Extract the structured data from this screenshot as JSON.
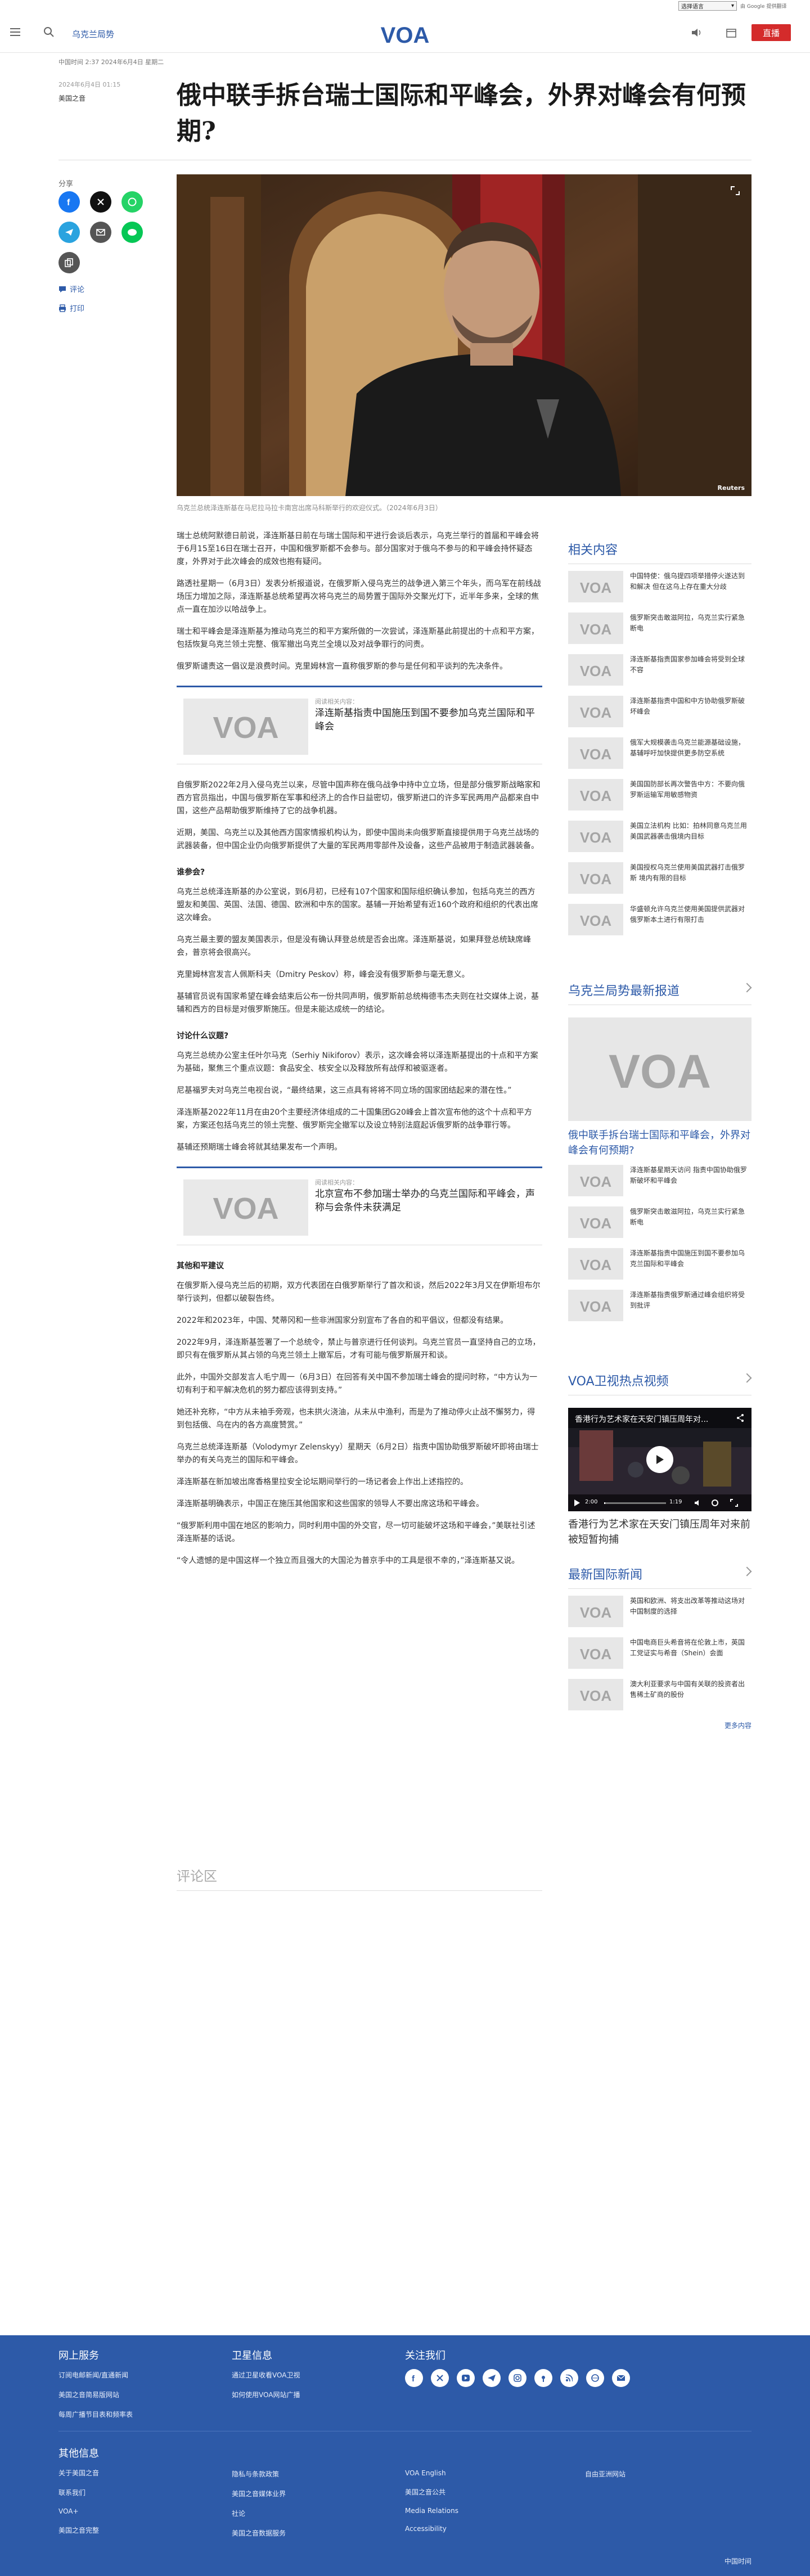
{
  "topbar": {
    "language_select": "选择语言",
    "google_translate": "由 Google 提供翻译"
  },
  "header": {
    "section": "乌克兰局势",
    "live": "直播",
    "logo": "VOA"
  },
  "article": {
    "kicker": "中国时间 2:37 2024年6月4日 星期二",
    "date": "2024年6月4日 01:15",
    "category": "美国之音",
    "title": "俄中联手拆台瑞士国际和平峰会，外界对峰会有何预期?",
    "share_label": "分享",
    "comment_link": "评论",
    "print_link": "打印",
    "photo_credit": "Reuters",
    "caption": "乌克兰总统泽连斯基在马尼拉马拉卡南宫出席马科斯举行的欢迎仪式。（2024年6月3日）",
    "paragraphs_a": [
      "瑞士总统阿默德日前说，泽连斯基日前在与瑞士国际和平进行会谈后表示，乌克兰举行的首届和平峰会将于6月15至16日在瑞士召开，中国和俄罗斯都不会参与。部分国家对于俄乌不参与的和平峰会持怀疑态度，外界对于此次峰会的成效也抱有疑问。",
      "路透社星期一（6月3日）发表分析报道说，在俄罗斯入侵乌克兰的战争进入第三个年头，而乌军在前线战场压力增加之际，泽连斯基总统希望再次将乌克兰的局势置于国际外交聚光灯下，近半年多来，全球的焦点一直在加沙以哈战争上。",
      "瑞士和平峰会是泽连斯基为推动乌克兰的和平方案所做的一次尝试，泽连斯基此前提出的十点和平方案，包括恢复乌克兰领土完整、俄军撤出乌克兰全境以及对战争罪行的问责。",
      "俄罗斯谴责这一倡议是浪费时间。克里姆林宫一直称俄罗斯的参与是任何和平谈判的先决条件。"
    ],
    "related_1": {
      "label": "阅读相关内容：",
      "title": "泽连斯基指责中国施压到国不要参加乌克兰国际和平峰会"
    },
    "paragraphs_b": [
      "自俄罗斯2022年2月入侵乌克兰以来，尽管中国声称在俄乌战争中持中立立场，但是部分俄罗斯战略家和西方官员指出，中国与俄罗斯在军事和经济上的合作日益密切，俄罗斯进口的许多军民两用产品都来自中国，这些产品帮助俄罗斯维持了它的战争机器。",
      "近期，美国、乌克兰以及其他西方国家情报机构认为，即使中国尚未向俄罗斯直接提供用于乌克兰战场的武器装备，但中国企业仍向俄罗斯提供了大量的军民两用零部件及设备，这些产品被用于制造武器装备。"
    ],
    "h_who": "谁参会?",
    "paragraphs_c": [
      "乌克兰总统泽连斯基的办公室说，到6月初，已经有107个国家和国际组织确认参加，包括乌克兰的西方盟友和美国、英国、法国、德国、欧洲和中东的国家。基辅一开始希望有近160个政府和组织的代表出席这次峰会。",
      "乌克兰最主要的盟友美国表示，但是没有确认拜登总统是否会出席。泽连斯基说，如果拜登总统缺席峰会，普京将会很高兴。",
      "克里姆林宫发言人佩斯科夫（Dmitry Peskov）称，峰会没有俄罗斯参与毫无意义。",
      "基辅官员说有国家希望在峰会结束后公布一份共同声明，俄罗斯前总统梅德韦杰夫则在社交媒体上说，基辅和西方的目标是对俄罗斯施压。但是未能达成统一的结论。"
    ],
    "h_topics": "讨论什么议题?",
    "paragraphs_d": [
      "乌克兰总统办公室主任叶尔马克（Serhiy Nikiforov）表示，这次峰会将以泽连斯基提出的十点和平方案为基础，聚焦三个重点议题：食品安全、核安全以及释放所有战俘和被驱逐者。",
      "尼基福罗夫对乌克兰电视台说，“最终结果，这三点具有将将不同立场的国家团结起来的潜在性。”",
      "泽连斯基2022年11月在由20个主要经济体组成的二十国集团G20峰会上首次宣布他的这个十点和平方案，方案还包括乌克兰的领土完整、俄罗斯完全撤军以及设立特别法庭起诉俄罗斯的战争罪行等。",
      "基辅还预期瑞士峰会将就其结果发布一个声明。"
    ],
    "related_2": {
      "label": "阅读相关内容：",
      "title": "北京宣布不参加瑞士举办的乌克兰国际和平峰会，声称与会条件未获满足"
    },
    "h_other": "其他和平建议",
    "paragraphs_e": [
      "在俄罗斯入侵乌克兰后的初期，双方代表团在白俄罗斯举行了首次和谈，然后2022年3月又在伊斯坦布尔举行谈判，但都以破裂告终。",
      "2022年和2023年，中国、梵蒂冈和一些非洲国家分别宣布了各自的和平倡议，但都没有结果。",
      "2022年9月，泽连斯基签署了一个总统令，禁止与普京进行任何谈判。乌克兰官员一直坚持自己的立场，即只有在俄罗斯从其占领的乌克兰领土上撤军后，才有可能与俄罗斯展开和谈。",
      "此外，中国外交部发言人毛宁周一（6月3日）在回答有关中国不参加瑞士峰会的提问时称，“中方认为一切有利于和平解决危机的努力都应该得到支持。”",
      "她还补充称，“中方从未袖手旁观，也未拱火浇油，从未从中渔利，而是为了推动停火止战不懈努力，得到包括俄、乌在内的各方高度赞赏。”",
      "乌克兰总统泽连斯基（Volodymyr Zelenskyy）星期天（6月2日）指责中国协助俄罗斯破坏即将由瑞士举办的有关乌克兰的国际和平峰会。",
      "泽连斯基在新加坡出席香格里拉安全论坛期间举行的一场记者会上作出上述指控的。",
      "泽连斯基明确表示，中国正在施压其他国家和这些国家的领导人不要出席这场和平峰会。",
      "“俄罗斯利用中国在地区的影响力，同时利用中国的外交官，尽一切可能破坏这场和平峰会，”美联社引述泽连斯基的话说。",
      "“令人遗憾的是中国这样一个独立而且强大的大国沦为普京手中的工具是很不幸的，”泽连斯基又说。"
    ],
    "comments_heading": "评论区"
  },
  "rail": {
    "related_heading": "相关内容",
    "related_items": [
      "中国特使：俄乌提四项举措停火遂达到和解决 但在这乌上存在重大分歧",
      "俄罗斯突击敢滋阿拉，乌克兰实行紧急断电",
      "泽连斯基指责国家参加峰会将受到全球不容",
      "泽连斯基指责中国和中方协助俄罗斯破坏峰会",
      "俄军大规模袭击乌克兰能源基础设施，基辅呼吁加快提供更多防空系统",
      "美国国防部长再次警告中方：不要向俄罗斯运输军用敏感物资",
      "美国立法机构 比如：拍林同意乌克兰用美国武器袭击俄境内目标",
      "美国授权乌克兰使用美国武器打击俄罗斯 境内有限的目标",
      "华盛顿允许乌克兰使用美国提供武器对俄罗斯本土进行有限打击"
    ],
    "latest_heading": "乌克兰局势最新报道",
    "latest_big": "俄中联手拆台瑞士国际和平峰会，外界对峰会有何预期?",
    "latest_items": [
      "泽连斯基星期天访问 指责中国协助俄罗斯破坏和平峰会",
      "俄罗斯突击敢滋阿拉，乌克兰实行紧急断电",
      "泽连斯基指责中国施压到国不要参加乌克兰国际和平峰会",
      "泽连斯基指责俄罗斯通过峰会组织将受到批评"
    ],
    "tv_heading": "VOA卫视热点视频",
    "video_title": "香港行为艺术家在天安门镇压周年对...",
    "video_time": "2:00",
    "video_duration": "1:19",
    "video_caption": "香港行为艺术家在天安门镇压周年对来前被短暂拘捕",
    "intl_heading": "最新国际新闻",
    "intl_items": [
      "英国和欧洲、将支出改革等推动这场对中国制度的选择",
      "中国电商巨头希音将在伦敦上市，英国工党证实与希音（Shein）会面",
      "澳大利亚要求与中国有关联的投资者出售稀土矿商的股份"
    ],
    "more": "更多内容"
  },
  "footer": {
    "col1_heading": "网上服务",
    "col1_links": [
      "订阅电邮新闻/直通新闻",
      "美国之音简易版网站",
      "每周广播节目表和频率表"
    ],
    "col2_heading": "卫星信息",
    "col2_links": [
      "通过卫星收看VOA卫视",
      "如何使用VOA网站广播"
    ],
    "col3_heading": "关注我们",
    "other_heading": "其他信息",
    "other_links": [
      "关于美国之音",
      "联系我们",
      "VOA+",
      "美国之音完整",
      "隐私与条款政策",
      "美国之音媒体业界",
      "社论",
      "美国之音数据服务",
      "VOA English",
      "美国之音公共",
      "Media Relations",
      "Accessibility",
      "自由亚洲网站"
    ],
    "bottom_right": "中国时间"
  },
  "colors": {
    "brand": "#2d5aa8",
    "live": "#d42b2b"
  }
}
